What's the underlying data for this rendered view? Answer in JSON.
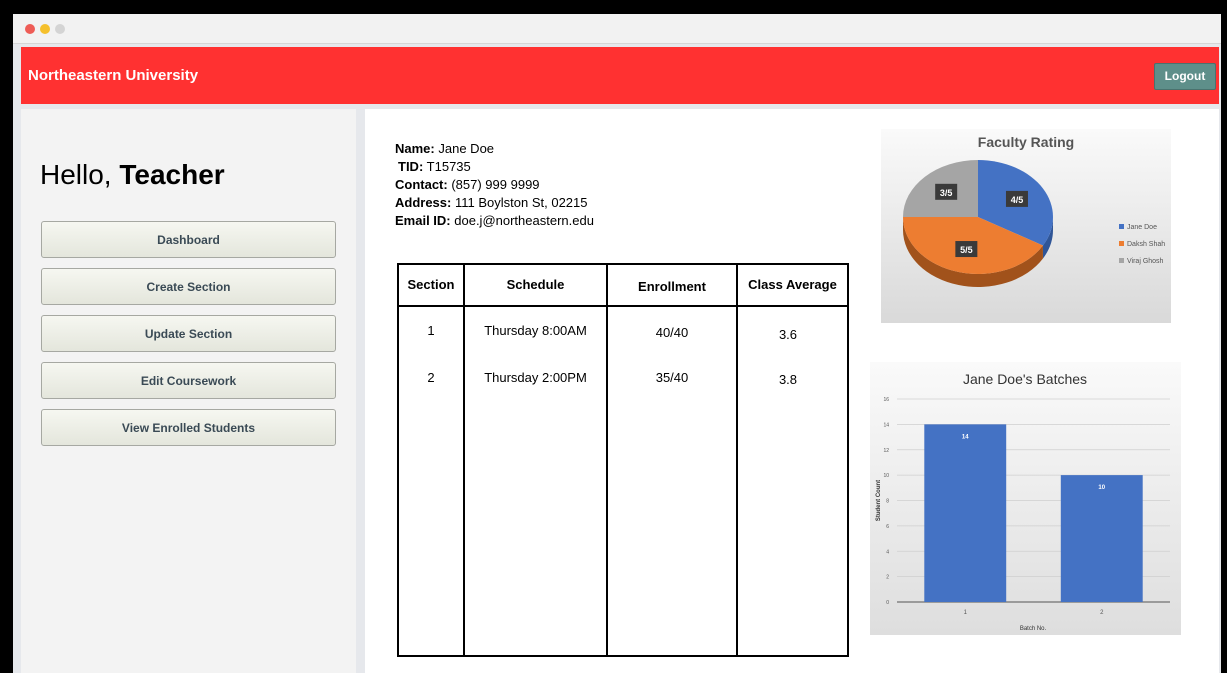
{
  "header": {
    "brand": "Northeastern University",
    "logout_label": "Logout"
  },
  "sidebar": {
    "greeting_prefix": "Hello,",
    "greeting_role": "Teacher",
    "items": [
      "Dashboard",
      "Create Section",
      "Update Section",
      "Edit Coursework",
      "View Enrolled Students"
    ]
  },
  "profile": {
    "name_label": "Name:",
    "name": "Jane Doe",
    "tid_label": "TID:",
    "tid": "T15735",
    "contact_label": "Contact:",
    "contact": "(857) 999 9999",
    "address_label": "Address:",
    "address": "111 Boylston St, 02215",
    "email_label": "Email ID:",
    "email": "doe.j@northeastern.edu"
  },
  "sections_table": {
    "headers": [
      "Section",
      "Schedule",
      "Enrollment",
      "Class Average"
    ],
    "rows": [
      [
        "1",
        "Thursday 8:00AM",
        "40/40",
        "3.6"
      ],
      [
        "2",
        "Thursday 2:00PM",
        "35/40",
        "3.8"
      ]
    ]
  },
  "colors": {
    "header_red": "#ff3131",
    "logout_teal": "#5e8f8a",
    "blue": "#4472c4",
    "orange": "#ed7d31",
    "gray": "#a5a5a5"
  },
  "chart_data": [
    {
      "type": "pie",
      "title": "Faculty Rating",
      "categories": [
        "Jane Doe",
        "Daksh Shah",
        "Viraj Ghosh"
      ],
      "values": [
        4,
        5,
        3
      ],
      "data_labels": [
        "4/5",
        "5/5",
        "3/5"
      ],
      "legend": "right"
    },
    {
      "type": "bar",
      "title": "Jane Doe's Batches",
      "categories": [
        "1",
        "2"
      ],
      "values": [
        14,
        10
      ],
      "data_labels": [
        "14",
        "10"
      ],
      "xlabel": "Batch No.",
      "ylabel": "Student Count",
      "ylim": [
        0,
        16
      ],
      "yticks": [
        "0",
        "2",
        "4",
        "6",
        "8",
        "10",
        "12",
        "14",
        "16"
      ],
      "grid": true
    }
  ]
}
